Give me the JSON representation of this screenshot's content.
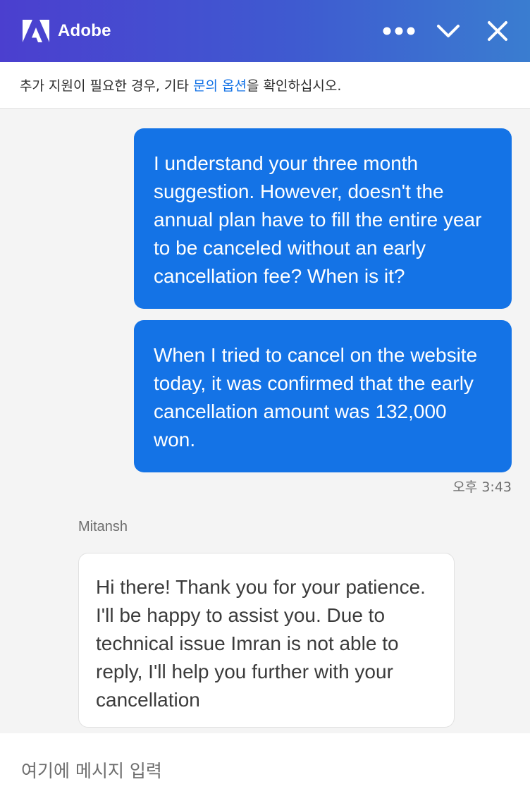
{
  "header": {
    "brand_name": "Adobe",
    "icons": {
      "logo": "adobe-logo-icon",
      "more": "more-options-icon",
      "minimize": "chevron-down-icon",
      "close": "close-icon"
    }
  },
  "notice": {
    "text_before": "추가 지원이 필요한 경우, 기타 ",
    "link_text": "문의 옵션",
    "text_after": "을 확인하십시오."
  },
  "messages": [
    {
      "from": "user",
      "text": "I understand your three month suggestion. However, doesn't the annual plan have to fill the entire year to be canceled without an early cancellation fee? When is it?"
    },
    {
      "from": "user",
      "text": "When I tried to cancel on the website today, it was confirmed that the early cancellation amount was 132,000 won."
    },
    {
      "from": "agent",
      "agent_name": "Mitansh",
      "text": "Hi there! Thank you for your patience. I'll be happy to assist you. Due to technical issue Imran is not able to reply, I'll help you further with your cancellation"
    }
  ],
  "timestamp": "오후 3:43",
  "composer": {
    "placeholder": "여기에 메시지 입력",
    "value": ""
  },
  "colors": {
    "header_gradient": [
      "#4b3fcf",
      "#3a7dd0"
    ],
    "user_bubble": "#1473e6",
    "link": "#1473e6",
    "background": "#f4f4f4"
  }
}
